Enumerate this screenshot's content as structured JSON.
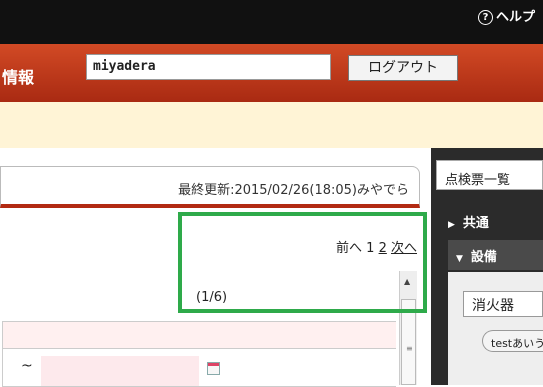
{
  "top": {
    "help_label": "ヘルプ"
  },
  "header": {
    "title": "情報",
    "username": "miyadera",
    "logout_label": "ログアウト"
  },
  "main": {
    "last_updated": "最終更新:2015/02/26(18:05)みやでら",
    "pager": {
      "prev": "前へ",
      "page1": "1",
      "page2": "2",
      "next": "次へ"
    },
    "page_count": "(1/6)",
    "tilde": "~"
  },
  "right": {
    "tab_label": "点検票一覧",
    "items": [
      {
        "label": "共通"
      },
      {
        "label": "設備"
      }
    ],
    "select_value": "消火器",
    "chip_label": "testあいう"
  },
  "colors": {
    "header_red": "#c0391b",
    "highlight_green": "#2eaa4a",
    "notice_bg": "#fff4d6"
  }
}
